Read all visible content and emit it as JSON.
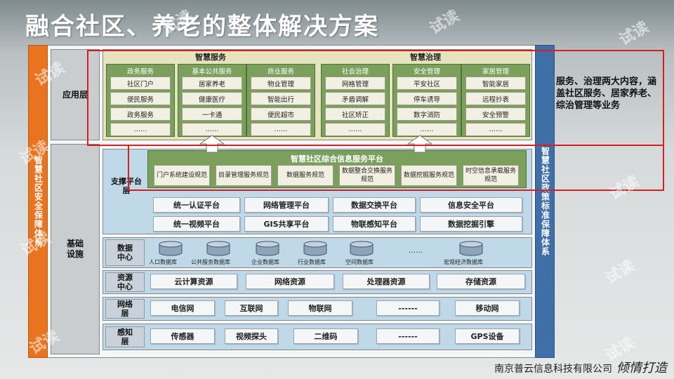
{
  "title": "融合社区、养老的整体解决方案",
  "left_bar": "智慧社区安全保障体系",
  "right_bar": "智慧社区政策标准保障体系",
  "layer_labels": {
    "application": "应用层",
    "foundation": "基础设施"
  },
  "app_groups": [
    {
      "title": "智慧服务",
      "columns": [
        {
          "title": "政务服务",
          "items": [
            "社区门户",
            "便民服务",
            "政务服务",
            "……"
          ]
        },
        {
          "title": "基本公共服务",
          "items": [
            "居家养老",
            "健康医疗",
            "一卡通",
            "……"
          ]
        },
        {
          "title": "商业服务",
          "items": [
            "物业管理",
            "智能出行",
            "便民超市",
            "……"
          ]
        }
      ]
    },
    {
      "title": "智慧治理",
      "columns": [
        {
          "title": "社会治理",
          "items": [
            "网格管理",
            "矛盾调解",
            "社区矫正",
            "……"
          ]
        },
        {
          "title": "安全管理",
          "items": [
            "平安社区",
            "停车诱导",
            "数字消防",
            "……"
          ]
        },
        {
          "title": "家居管理",
          "items": [
            "智能家居",
            "远程抄表",
            "安全预警",
            "……"
          ]
        }
      ]
    }
  ],
  "support": {
    "label": "支撑平台层",
    "platform_title": "智慧社区综合信息服务平台",
    "platform_items": [
      "门户系统建设规范",
      "目录管理服务规范",
      "数据服务规范",
      "数据整合交换服务规范",
      "数据挖掘服务规范",
      "时空信息承载服务规范"
    ],
    "services_row1": [
      "统一认证平台",
      "网络管理平台",
      "数据交换平台",
      "信息安全平台"
    ],
    "services_row2": [
      "统一视频平台",
      "GIS共享平台",
      "物联感知平台",
      "数据挖掘引擎"
    ]
  },
  "data_center": {
    "label": "数据中心",
    "databases": [
      "人口数据库",
      "公共服务数据库",
      "企业数据库",
      "行业数据库",
      "空间数据库",
      "宏观经济数据库"
    ],
    "ellipsis": "……"
  },
  "resource_center": {
    "label": "资源中心",
    "items": [
      "云计算资源",
      "网络资源",
      "处理器资源",
      "存储资源"
    ]
  },
  "network_layer": {
    "label": "网络层",
    "items": [
      "电信网",
      "互联网",
      "物联网",
      "------",
      "移动网"
    ]
  },
  "perception_layer": {
    "label": "感知层",
    "items": [
      "传感器",
      "视频探头",
      "二维码",
      "------",
      "GPS设备"
    ]
  },
  "annotation": "服务、治理两大内容，涵盖社区服务、居家养老、综治管理等业务",
  "footer": {
    "company": "南京普云信息科技有限公司",
    "slogan": "倾情打造"
  },
  "watermark": "试读",
  "colors": {
    "orange_bar": "#e8741f",
    "blue_bar": "#3f6fa7",
    "green_box": "#7aa05c",
    "red_highlight": "#d81e1e"
  }
}
